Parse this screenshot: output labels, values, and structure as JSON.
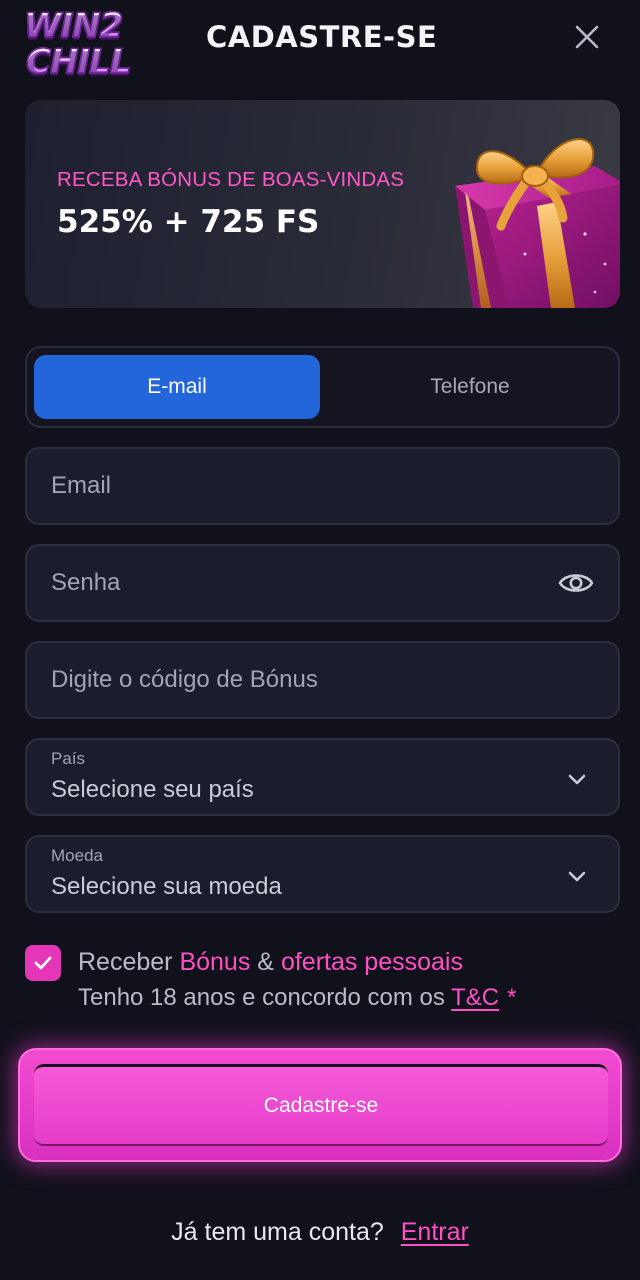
{
  "header": {
    "logo_line1": "WIN2",
    "logo_line2": "CHILL",
    "title": "CADASTRE-SE",
    "close_icon": "close-icon"
  },
  "promo": {
    "subtitle": "RECEBA BÓNUS DE BOAS-VINDAS",
    "amount": "525% + 725 FS",
    "image_icon": "gift-box-icon"
  },
  "tabs": [
    {
      "label": "E-mail",
      "active": true
    },
    {
      "label": "Telefone",
      "active": false
    }
  ],
  "form": {
    "email": {
      "placeholder": "Email",
      "value": ""
    },
    "password": {
      "placeholder": "Senha",
      "value": "",
      "toggle_icon": "eye-icon"
    },
    "bonus_code": {
      "placeholder": "Digite o código de Bónus",
      "value": ""
    },
    "country": {
      "label": "País",
      "value": "Selecione seu país",
      "icon": "chevron-down-icon"
    },
    "currency": {
      "label": "Moeda",
      "value": "Selecione sua moeda",
      "icon": "chevron-down-icon"
    }
  },
  "consent": {
    "checked": true,
    "line1_prefix": "Receber",
    "line1_bonus": "Bónus",
    "line1_amp": "&",
    "line1_offers": "ofertas pessoais",
    "line2_prefix": "Tenho 18 anos e concordo com os",
    "line2_link": "T&C",
    "line2_required": "*"
  },
  "submit_label": "Cadastre-se",
  "footer": {
    "question": "Já tem uma conta?",
    "login_link": "Entrar"
  },
  "colors": {
    "background": "#11111b",
    "accent_pink": "#e535b9",
    "tab_active": "#2366d9",
    "field_bg": "#1c1d2c"
  }
}
